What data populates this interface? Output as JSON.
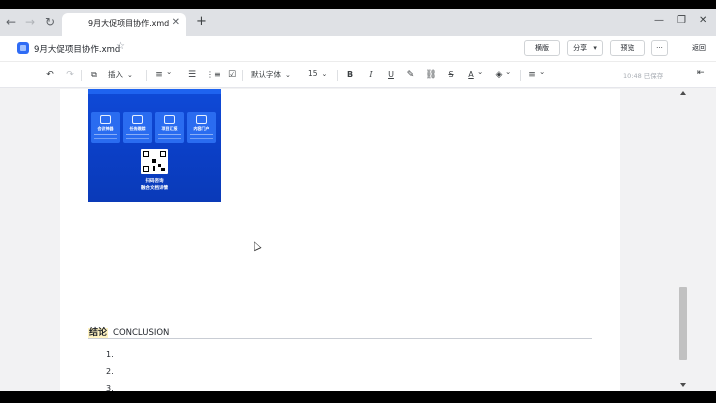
{
  "browser": {
    "tab_title": "9月大促项目协作.xmd",
    "close_glyph": "✕",
    "new_tab_glyph": "+",
    "back_glyph": "←",
    "forward_glyph": "→",
    "reload_glyph": "↻",
    "minimize_glyph": "—",
    "restore_glyph": "❐",
    "window_close_glyph": "✕"
  },
  "header": {
    "doc_title": "9月大促项目协作.xmd",
    "star_glyph": "☆",
    "landscape_label": "横版",
    "share_label": "分享",
    "share_caret": "▾",
    "preview_label": "预览",
    "more_label": "···",
    "back_label": "返回"
  },
  "toolbar": {
    "undo": "↶",
    "redo": "↷",
    "insert_label": "插入",
    "font_family": "默认字体",
    "font_size": "15",
    "bold": "B",
    "italic": "I",
    "underline": "U",
    "strike": "S",
    "caret": "⌄",
    "saved_status": "10:48 已保存",
    "collapse": "⇤"
  },
  "poster": {
    "tiles": [
      {
        "label": "会议神器"
      },
      {
        "label": "任务跟踪"
      },
      {
        "label": "项目汇报"
      },
      {
        "label": "内容门户"
      }
    ],
    "cta_line1": "扫码咨询",
    "cta_line2": "融合文档详情"
  },
  "document": {
    "heading_cn": "结论",
    "heading_en": "CONCLUSION",
    "list": [
      "1.",
      "2.",
      "3."
    ]
  },
  "icons": [
    "back-arrow-icon",
    "forward-arrow-icon",
    "reload-icon",
    "doc-logo-icon",
    "star-icon",
    "undo-icon",
    "redo-icon",
    "insert-icon",
    "align-icon",
    "bullet-list-icon",
    "numbered-list-icon",
    "task-list-icon",
    "bold-icon",
    "italic-icon",
    "underline-icon",
    "highlight-icon",
    "link-icon",
    "strikethrough-icon",
    "text-color-icon",
    "background-color-icon",
    "paragraph-align-icon",
    "collapse-panel-icon"
  ]
}
